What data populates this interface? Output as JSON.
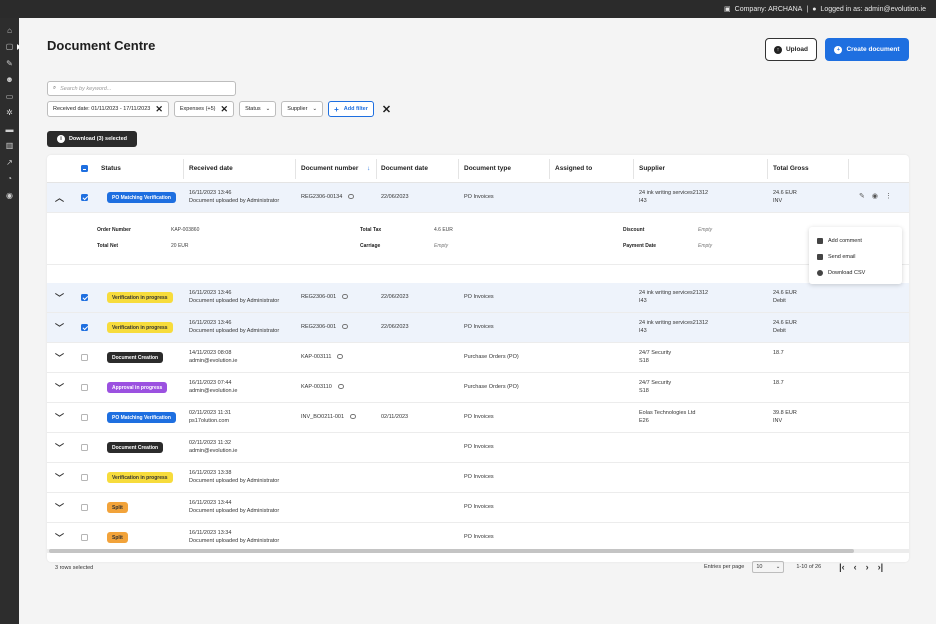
{
  "topbar": {
    "company_text": "Company: ARCHANA",
    "login_text": "Logged in as: admin@evolution.ie"
  },
  "sidebar": {
    "icons": [
      "home-icon",
      "document-icon",
      "edit-icon",
      "users-icon",
      "box-icon",
      "gear-icon",
      "mail-icon",
      "chart-icon",
      "trend-icon",
      "clock-icon",
      "logout-icon"
    ]
  },
  "page": {
    "title": "Document Centre"
  },
  "toolbar": {
    "upload_label": "Upload",
    "create_label": "Create document"
  },
  "search": {
    "placeholder": "Search by keyword..."
  },
  "filters": {
    "chips": [
      "Received date: 01/11/2023 - 17/11/2023",
      "Expenses (+5)"
    ],
    "dropdowns": [
      "Status",
      "Supplier"
    ],
    "add_label": "Add filter"
  },
  "download": {
    "label": "Download (3) selected"
  },
  "table": {
    "columns": [
      "Status",
      "Received date",
      "Document number",
      "Document date",
      "Document type",
      "Assigned to",
      "Supplier",
      "Total Gross"
    ],
    "rows": [
      {
        "status": "PO Matching Verification",
        "received_1": "16/11/2023 13:46",
        "received_2": "Document uploaded by Administrator",
        "doc_no": "REG2306-00134",
        "doc_date": "22/06/2023",
        "doc_type": "PO Invoices",
        "supplier_1": "24 ink writing services21312",
        "supplier_2": "I43",
        "gross_1": "24.6 EUR",
        "gross_2": "INV"
      },
      {
        "status": "Verification in progress",
        "received_1": "16/11/2023 13:46",
        "received_2": "Document uploaded by Administrator",
        "doc_no": "REG2306-001",
        "doc_date": "22/06/2023",
        "doc_type": "PO Invoices",
        "supplier_1": "24 ink writing services21312",
        "supplier_2": "I43",
        "gross_1": "24.6 EUR",
        "gross_2": "Debit"
      },
      {
        "status": "Verification in progress",
        "received_1": "16/11/2023 13:46",
        "received_2": "Document uploaded by Administrator",
        "doc_no": "REG2306-001",
        "doc_date": "22/06/2023",
        "doc_type": "PO Invoices",
        "supplier_1": "24 ink writing services21312",
        "supplier_2": "I43",
        "gross_1": "24.6 EUR",
        "gross_2": "Debit"
      },
      {
        "status": "Document Creation",
        "received_1": "14/11/2023 08:08",
        "received_2": "admin@evolution.ie",
        "doc_no": "KAP-003111",
        "doc_date": "",
        "doc_type": "Purchase Orders (PO)",
        "supplier_1": "24/7 Security",
        "supplier_2": "S18",
        "gross_1": "18.7",
        "gross_2": ""
      },
      {
        "status": "Approval in progress",
        "received_1": "16/11/2023 07:44",
        "received_2": "admin@evolution.ie",
        "doc_no": "KAP-003110",
        "doc_date": "",
        "doc_type": "Purchase Orders (PO)",
        "supplier_1": "24/7 Security",
        "supplier_2": "S18",
        "gross_1": "18.7",
        "gross_2": ""
      },
      {
        "status": "PO Matching Verification",
        "received_1": "02/11/2023 11:31",
        "received_2": "ps17olution.com",
        "doc_no": "INV_BO0211-001",
        "doc_date": "02/11/2023",
        "doc_type": "PO Invoices",
        "supplier_1": "Eolas Technologies Ltd",
        "supplier_2": "E26",
        "gross_1": "39.8 EUR",
        "gross_2": "INV"
      },
      {
        "status": "Document Creation",
        "received_1": "02/11/2023 11:32",
        "received_2": "admin@evolution.ie",
        "doc_no": "",
        "doc_date": "",
        "doc_type": "PO Invoices",
        "supplier_1": "",
        "supplier_2": "",
        "gross_1": "",
        "gross_2": ""
      },
      {
        "status": "Verification in progress",
        "received_1": "16/11/2023 13:38",
        "received_2": "Document uploaded by Administrator",
        "doc_no": "",
        "doc_date": "",
        "doc_type": "PO Invoices",
        "supplier_1": "",
        "supplier_2": "",
        "gross_1": "",
        "gross_2": ""
      },
      {
        "status": "Split",
        "received_1": "16/11/2023 13:44",
        "received_2": "Document uploaded by Administrator",
        "doc_no": "",
        "doc_date": "",
        "doc_type": "PO Invoices",
        "supplier_1": "",
        "supplier_2": "",
        "gross_1": "",
        "gross_2": ""
      },
      {
        "status": "Split",
        "received_1": "16/11/2023 13:34",
        "received_2": "Document uploaded by Administrator",
        "doc_no": "",
        "doc_date": "",
        "doc_type": "PO Invoices",
        "supplier_1": "",
        "supplier_2": "",
        "gross_1": "",
        "gross_2": ""
      }
    ],
    "detail": {
      "order_number_label": "Order Number",
      "order_number": "KAP-003860",
      "total_net_label": "Total Net",
      "total_net": "20 EUR",
      "total_tax_label": "Total Tax",
      "total_tax": "4.6 EUR",
      "carriage_label": "Carriage",
      "carriage": "Empty",
      "discount_label": "Discount",
      "discount": "Empty",
      "payment_date_label": "Payment Date",
      "payment_date": "Empty"
    }
  },
  "context_menu": {
    "items": [
      "Add comment",
      "Send email",
      "Download CSV"
    ]
  },
  "footer": {
    "rows_selected": "3 rows selected",
    "per_page_label": "Entries per page",
    "per_page": "10",
    "range": "1-10 of 26"
  },
  "colors": {
    "primary": "#1e6fe0",
    "badge_blue": "#1e6fe0",
    "badge_yellow": "#f7dc3c",
    "badge_dark": "#2b2b2b",
    "badge_purple": "#9b51e0",
    "badge_orange": "#f2a33a"
  }
}
